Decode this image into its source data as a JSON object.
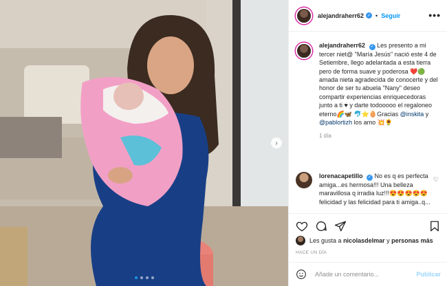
{
  "post": {
    "author": "alejandraherr62",
    "follow_label": "Seguir",
    "more_label": "•••",
    "separator": "•",
    "caption": {
      "text_1": "Les presento a mi tercer niet@ \"María Jesús\" nació este 4 de Setiembre, llego adelantada a esta tierra pero de forma suave y poderosa ",
      "emoji_1": "❤️",
      "emoji_2": "🟢",
      "text_2": "amada nieta agradecida de conocerte y del honor de ser tu abuela \"Nany\" deseo compartir experiencias enriquecedoras junto a ti ",
      "emoji_3": "♥",
      "text_3": " y darte todooooo el regaloneo eterno",
      "emoji_4": "🌈🦋",
      "emoji_5": "🐬⭐🥚",
      "text_4": "Gracias ",
      "mention_1": "@inskita",
      "text_5": " y ",
      "mention_2": "@pablortizh",
      "text_6": " los amo ",
      "emoji_6": "💥🌻",
      "age": "1 día"
    },
    "comment": {
      "author": "lorenacapetillo",
      "text_1": " No es q es perfecta amiga...es hermosa!!! Una belleza maravillosa q irradia luz!!!",
      "emoji": "😍😍😍😍😍",
      "text_2": " felicidad y las felicidad para ti amiga..q..."
    },
    "likes": {
      "prefix": "Les gusta a ",
      "user": "nicolasdelmar",
      "middle": " y ",
      "others": "personas más"
    },
    "time": "HACE UN DÍA",
    "add_comment": {
      "placeholder": "Añade un comentario...",
      "publish_label": "Publicar"
    },
    "carousel": {
      "next_label": "›",
      "slides": 4,
      "active": 1
    }
  },
  "icons": [
    "verified-badge-icon",
    "heart-icon",
    "comment-icon",
    "share-icon",
    "save-icon",
    "emoji-icon",
    "more-icon",
    "chevron-right-icon"
  ],
  "colors": {
    "accent": "#0095f6",
    "verified": "#3897f0",
    "border": "#efefef",
    "muted": "#8e8e8e"
  }
}
